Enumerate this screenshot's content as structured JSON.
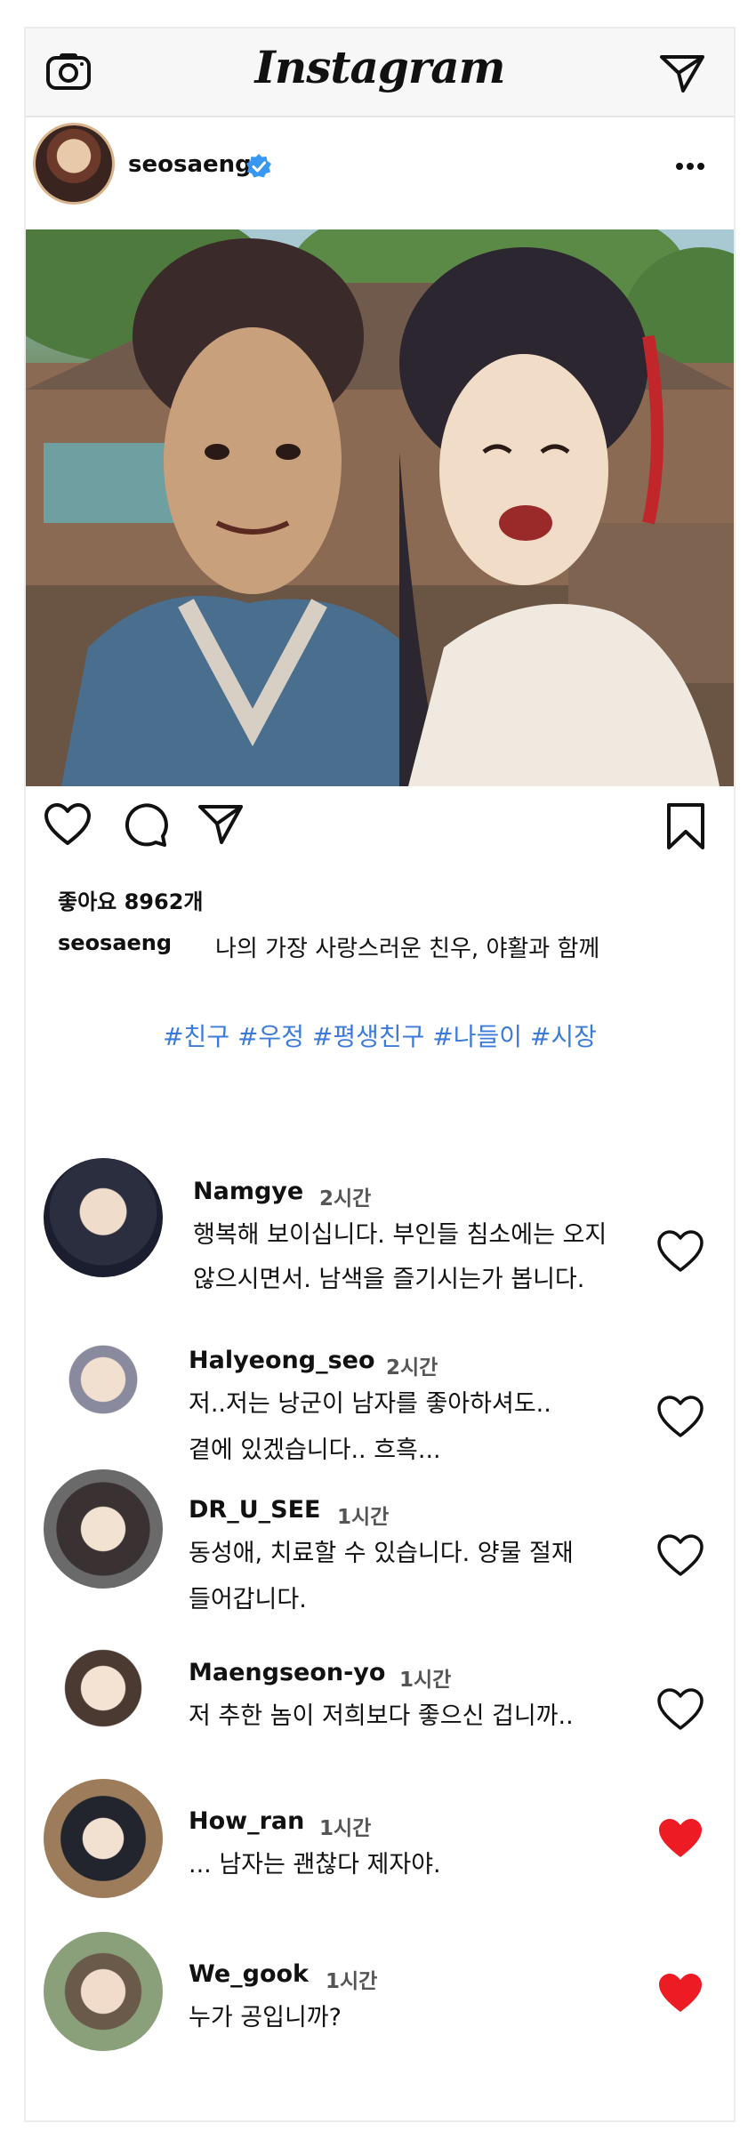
{
  "header": {
    "brand": "Instagram"
  },
  "post": {
    "username": "seosaeng",
    "likes_text": "좋아요 8962개",
    "caption_user": "seosaeng",
    "caption_text": "나의 가장 사랑스러운 친우, 야활과 함께",
    "hashtags": "#친구 #우정 #평생친구 #나들이 #시장"
  },
  "comments": [
    {
      "user": "Namgye",
      "time": "2시간",
      "lines": [
        "행복해 보이십니다. 부인들 침소에는 오지",
        "않으시면서. 남색을 즐기시는가 봅니다."
      ],
      "liked": false
    },
    {
      "user": "Halyeong_seo",
      "time": "2시간",
      "lines": [
        "저..저는 낭군이 남자를 좋아하셔도..",
        "곁에 있겠습니다.. 흐흑..."
      ],
      "liked": false
    },
    {
      "user": "DR_U_SEE",
      "time": "1시간",
      "lines": [
        "동성애, 치료할 수 있습니다. 양물 절재",
        "들어갑니다."
      ],
      "liked": false
    },
    {
      "user": "Maengseon-yo",
      "time": "1시간",
      "lines": [
        "저 추한 놈이 저희보다 좋으신 겁니까.."
      ],
      "liked": false
    },
    {
      "user": "How_ran",
      "time": "1시간",
      "lines": [
        "... 남자는 괜찮다 제자야."
      ],
      "liked": true
    },
    {
      "user": "We_gook",
      "time": "1시간",
      "lines": [
        "누가 공입니까?"
      ],
      "liked": true
    }
  ],
  "colors": {
    "link_blue": "#3d7bd8",
    "verified_blue": "#3897f0",
    "liked_red": "#ed1c24"
  }
}
